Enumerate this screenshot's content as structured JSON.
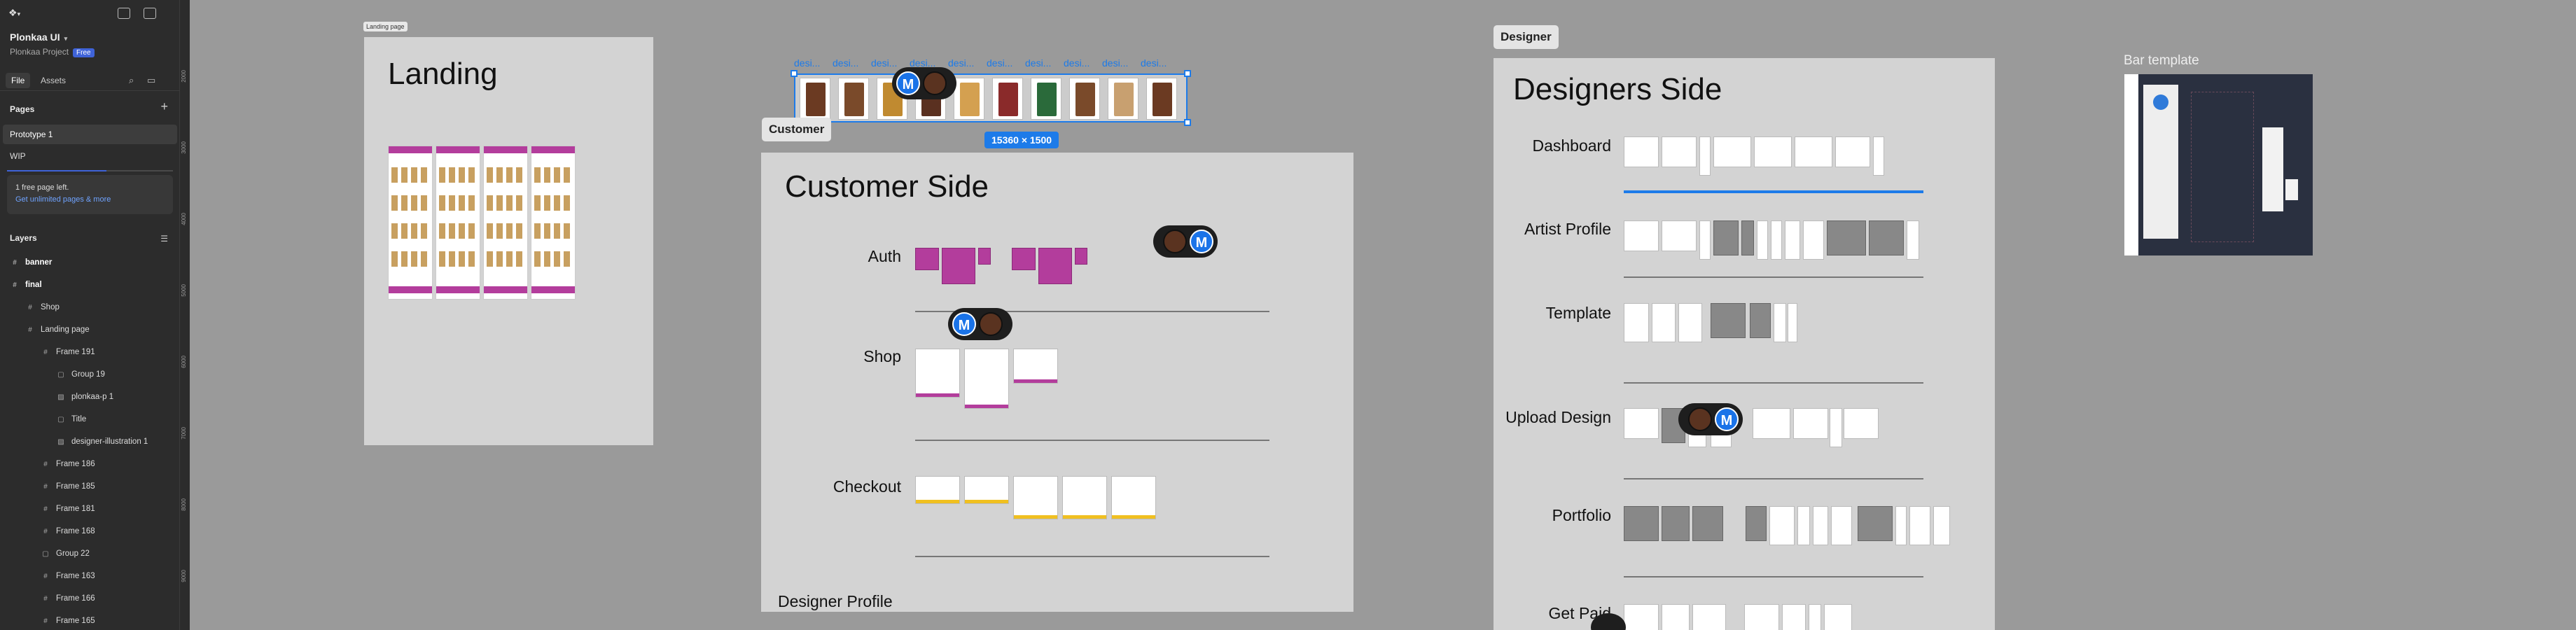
{
  "app": {
    "file_name": "Plonkaa UI",
    "project": "Plonkaa Project",
    "plan_badge": "Free"
  },
  "tabs": [
    "File",
    "Assets"
  ],
  "pages": {
    "title": "Pages",
    "items": [
      "Prototype 1",
      "WIP"
    ],
    "active": "Prototype 1"
  },
  "upsell": {
    "line1": "1 free page left.",
    "line2": "Get unlimited pages & more",
    "progress_fraction": 0.6
  },
  "layers": {
    "title": "Layers",
    "items": [
      {
        "label": "banner",
        "level": 0,
        "icon": "frame-icon"
      },
      {
        "label": "final",
        "level": 0,
        "icon": "frame-icon"
      },
      {
        "label": "Shop",
        "level": 1,
        "icon": "frame-icon"
      },
      {
        "label": "Landing page",
        "level": 1,
        "icon": "frame-icon"
      },
      {
        "label": "Frame 191",
        "level": 2,
        "icon": "frame-icon"
      },
      {
        "label": "Group 19",
        "level": 3,
        "icon": "group-icon"
      },
      {
        "label": "plonkaa-p 1",
        "level": 3,
        "icon": "image-icon"
      },
      {
        "label": "Title",
        "level": 3,
        "icon": "group-icon"
      },
      {
        "label": "designer-illustration 1",
        "level": 3,
        "icon": "image-icon"
      },
      {
        "label": "Frame 186",
        "level": 2,
        "icon": "frame-icon"
      },
      {
        "label": "Frame 185",
        "level": 2,
        "icon": "frame-icon"
      },
      {
        "label": "Frame 181",
        "level": 2,
        "icon": "frame-icon"
      },
      {
        "label": "Frame 168",
        "level": 2,
        "icon": "frame-icon"
      },
      {
        "label": "Group 22",
        "level": 2,
        "icon": "group-icon"
      },
      {
        "label": "Frame 163",
        "level": 2,
        "icon": "frame-icon"
      },
      {
        "label": "Frame 166",
        "level": 2,
        "icon": "frame-icon"
      },
      {
        "label": "Frame 165",
        "level": 2,
        "icon": "frame-icon"
      }
    ]
  },
  "ruler_marks": [
    "2000",
    "3000",
    "4000",
    "5000",
    "6000",
    "7000",
    "8000",
    "9000"
  ],
  "canvas": {
    "landing_tag": "Landing page",
    "landing_title": "Landing",
    "customer_chip": "Customer",
    "customer_title": "Customer Side",
    "customer_rows": [
      "Auth",
      "Shop",
      "Checkout"
    ],
    "customer_footer": "Designer Profile",
    "designer_chip": "Designer",
    "designer_title": "Designers Side",
    "designer_rows": [
      "Dashboard",
      "Artist Profile",
      "Template",
      "Upload Design",
      "Portfolio",
      "Get Paid"
    ],
    "banner_labels": [
      "desi...",
      "desi...",
      "desi...",
      "desi...",
      "desi...",
      "desi...",
      "desi...",
      "desi...",
      "desi...",
      "desi..."
    ],
    "selection_size": "15360 × 1500",
    "bar_template_label": "Bar template",
    "cursor_initial": "M"
  },
  "colors": {
    "selection": "#1d7be9",
    "accent_purple": "#b33d9c",
    "accent_yellow": "#f0c020",
    "sidebar_bg": "#2c2c2c",
    "canvas_bg": "#9a9a9a"
  }
}
